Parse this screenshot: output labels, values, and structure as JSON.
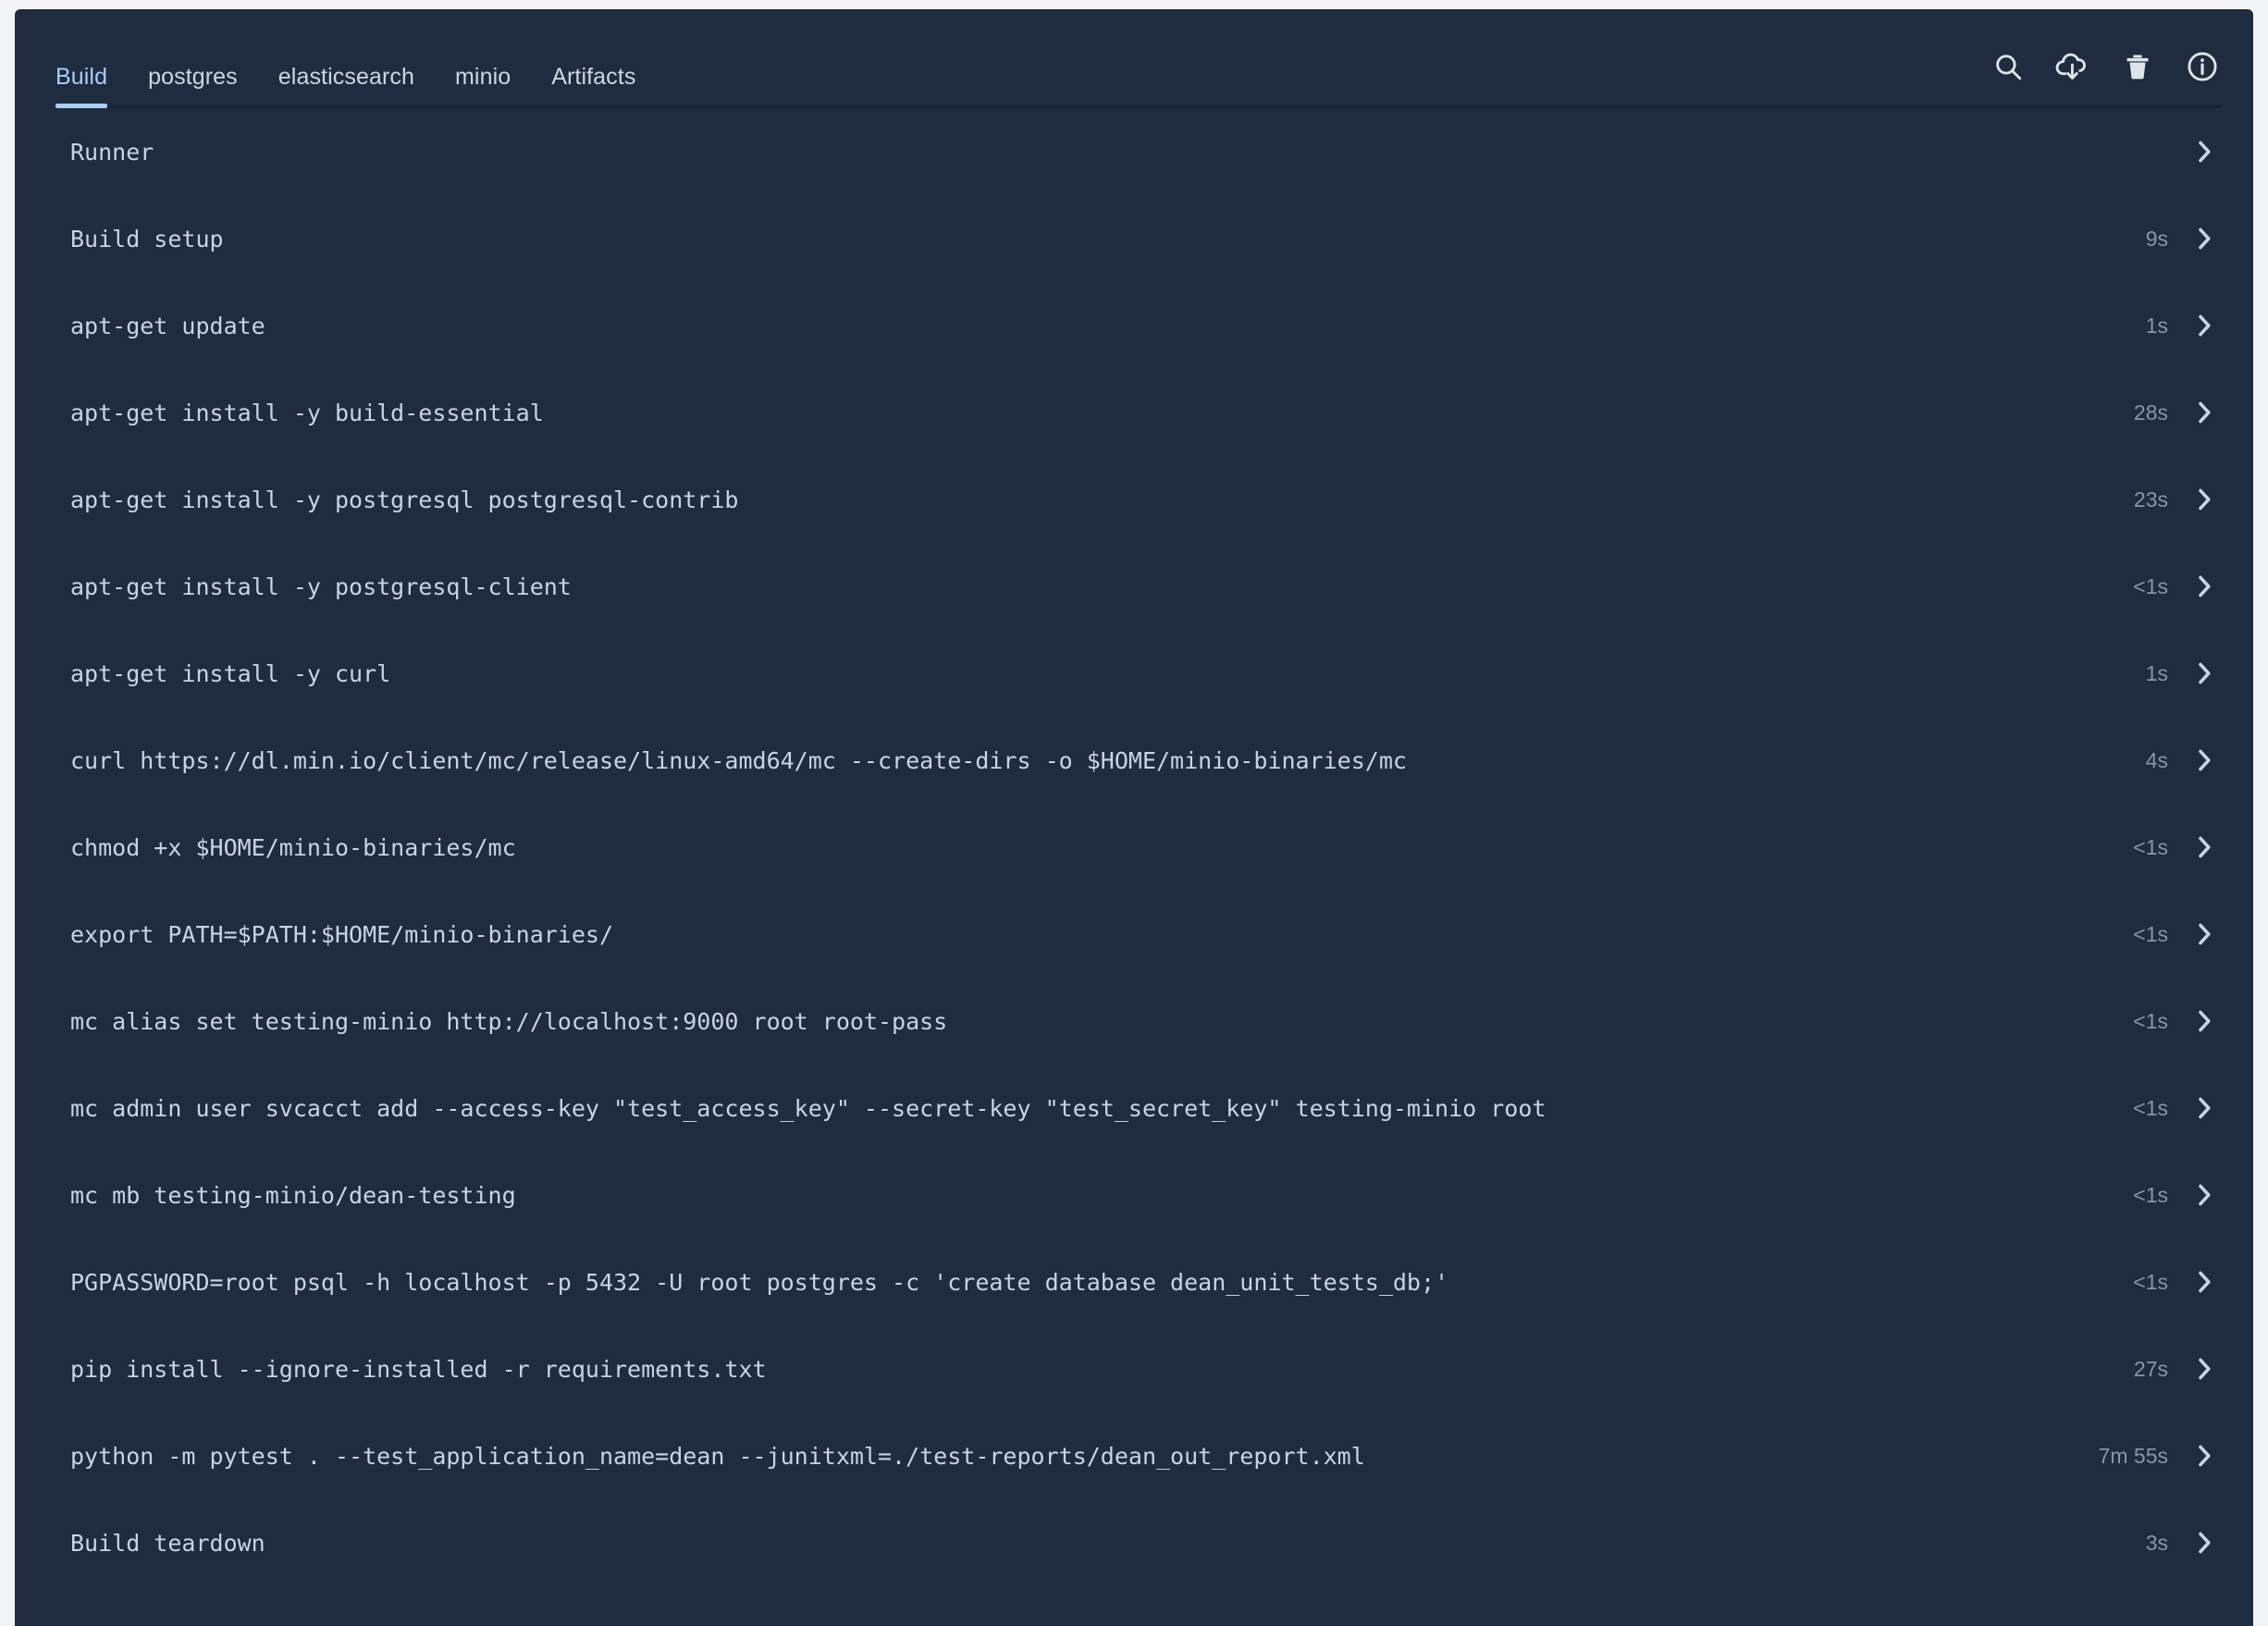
{
  "header": {
    "tabs": [
      {
        "label": "Build",
        "active": true
      },
      {
        "label": "postgres",
        "active": false
      },
      {
        "label": "elasticsearch",
        "active": false
      },
      {
        "label": "minio",
        "active": false
      },
      {
        "label": "Artifacts",
        "active": false
      }
    ],
    "actions": [
      {
        "name": "search-icon",
        "title": "Search"
      },
      {
        "name": "cloud-download-icon",
        "title": "Download"
      },
      {
        "name": "trash-icon",
        "title": "Delete"
      },
      {
        "name": "info-icon",
        "title": "Info"
      }
    ]
  },
  "colors": {
    "panel_background": "#1f2b3e",
    "page_background": "#f2f3f5",
    "accent": "#a8cdf7",
    "text": "#c6d4e6",
    "muted_text": "#8795aa",
    "divider": "#16213a"
  },
  "rows": [
    {
      "label": "Runner",
      "duration": ""
    },
    {
      "label": "Build setup",
      "duration": "9s"
    },
    {
      "label": "apt-get update",
      "duration": "1s"
    },
    {
      "label": "apt-get install -y build-essential",
      "duration": "28s"
    },
    {
      "label": "apt-get install -y postgresql postgresql-contrib",
      "duration": "23s"
    },
    {
      "label": "apt-get install -y postgresql-client",
      "duration": "<1s"
    },
    {
      "label": "apt-get install -y curl",
      "duration": "1s"
    },
    {
      "label": "curl https://dl.min.io/client/mc/release/linux-amd64/mc --create-dirs -o $HOME/minio-binaries/mc",
      "duration": "4s"
    },
    {
      "label": "chmod +x $HOME/minio-binaries/mc",
      "duration": "<1s"
    },
    {
      "label": "export PATH=$PATH:$HOME/minio-binaries/",
      "duration": "<1s"
    },
    {
      "label": "mc alias set testing-minio http://localhost:9000 root root-pass",
      "duration": "<1s"
    },
    {
      "label": "mc admin user svcacct add --access-key \"test_access_key\" --secret-key \"test_secret_key\" testing-minio root",
      "duration": "<1s"
    },
    {
      "label": "mc mb testing-minio/dean-testing",
      "duration": "<1s"
    },
    {
      "label": "PGPASSWORD=root psql -h localhost -p 5432 -U root postgres -c 'create database dean_unit_tests_db;'",
      "duration": "<1s"
    },
    {
      "label": "pip install --ignore-installed -r requirements.txt",
      "duration": "27s"
    },
    {
      "label": "python -m pytest . --test_application_name=dean --junitxml=./test-reports/dean_out_report.xml",
      "duration": "7m 55s"
    },
    {
      "label": "Build teardown",
      "duration": "3s"
    }
  ]
}
